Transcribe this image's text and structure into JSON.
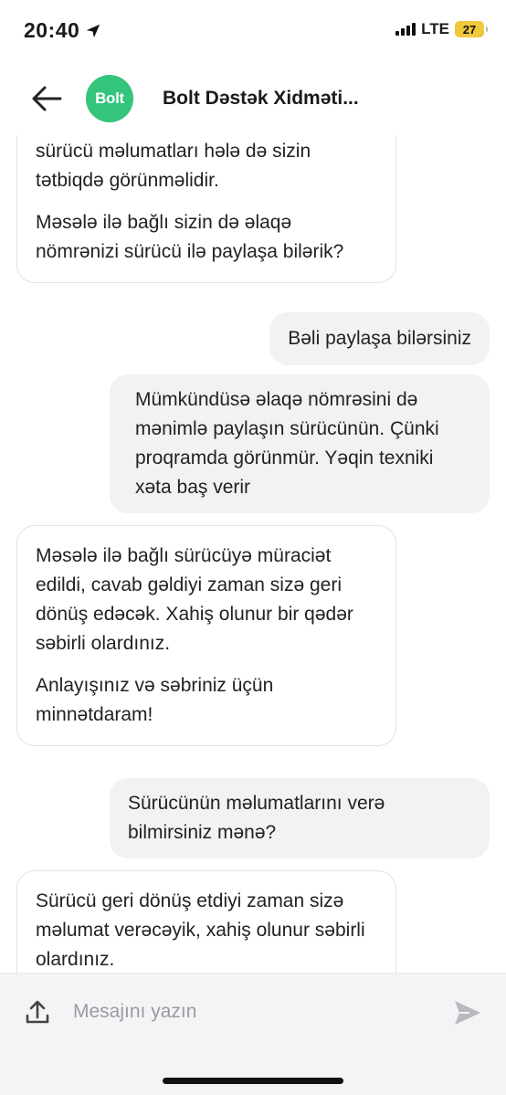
{
  "status_bar": {
    "time": "20:40",
    "network": "LTE",
    "battery": "27"
  },
  "header": {
    "back_icon": "arrow-left-icon",
    "avatar_text": "Bolt",
    "title": "Bolt Dəstək Xidməti..."
  },
  "messages": [
    {
      "sender": "support",
      "paragraphs": [
        "sürücü məlumatları hələ də sizin tətbiqdə görünməlidir.",
        "Məsələ ilə bağlı sizin də əlaqə nömrənizi sürücü ilə paylaşa bilərik?"
      ]
    },
    {
      "sender": "user",
      "paragraphs": [
        "Bəli paylaşa bilərsiniz"
      ]
    },
    {
      "sender": "user",
      "paragraphs": [
        "Mümkündüsə əlaqə nömrəsini də mənimlə paylaşın sürücünün. Çünki proqramda görünmür. Yəqin texniki xəta baş verir"
      ]
    },
    {
      "sender": "support",
      "paragraphs": [
        "Məsələ ilə bağlı sürücüyə müraciət edildi, cavab gəldiyi zaman sizə geri dönüş edəcək. Xahiş olunur bir qədər səbirli olardınız.",
        "Anlayışınız və səbriniz üçün minnətdaram!"
      ]
    },
    {
      "sender": "user",
      "paragraphs": [
        "Sürücünün məlumatlarını verə bilmirsiniz mənə?"
      ]
    },
    {
      "sender": "support",
      "paragraphs": [
        "Sürücü geri dönüş etdiyi zaman sizə məlumat verəcəyik, xahiş olunur səbirli olardınız."
      ]
    }
  ],
  "composer": {
    "placeholder": "Mesajını yazın",
    "upload_icon": "upload-icon",
    "send_icon": "send-icon"
  },
  "colors": {
    "brand": "#34c47c",
    "outgoing_bubble": "#f2f2f4",
    "incoming_border": "#e2e2e2"
  }
}
